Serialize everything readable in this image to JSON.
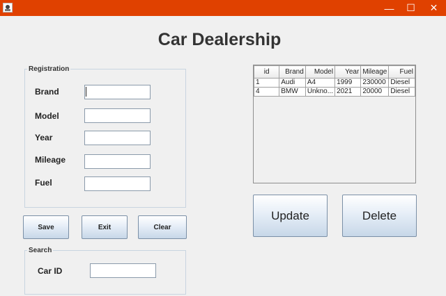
{
  "window": {
    "minimize_glyph": "—",
    "maximize_glyph": "☐",
    "close_glyph": "✕"
  },
  "app_title": "Car Dealership",
  "registration": {
    "legend": "Registration",
    "fields": {
      "brand": {
        "label": "Brand",
        "value": ""
      },
      "model": {
        "label": "Model",
        "value": ""
      },
      "year": {
        "label": "Year",
        "value": ""
      },
      "mileage": {
        "label": "Mileage",
        "value": ""
      },
      "fuel": {
        "label": "Fuel",
        "value": ""
      }
    }
  },
  "buttons": {
    "save": "Save",
    "exit": "Exit",
    "clear": "Clear",
    "update": "Update",
    "delete": "Delete"
  },
  "search": {
    "legend": "Search",
    "car_id_label": "Car ID",
    "car_id_value": ""
  },
  "table": {
    "columns": [
      "id",
      "Brand",
      "Model",
      "Year",
      "Mileage",
      "Fuel"
    ],
    "rows": [
      [
        "1",
        "Audi",
        "A4",
        "1999",
        "230000",
        "Diesel"
      ],
      [
        "4",
        "BMW",
        "Unkno...",
        "2021",
        "20000",
        "Diesel"
      ]
    ]
  }
}
